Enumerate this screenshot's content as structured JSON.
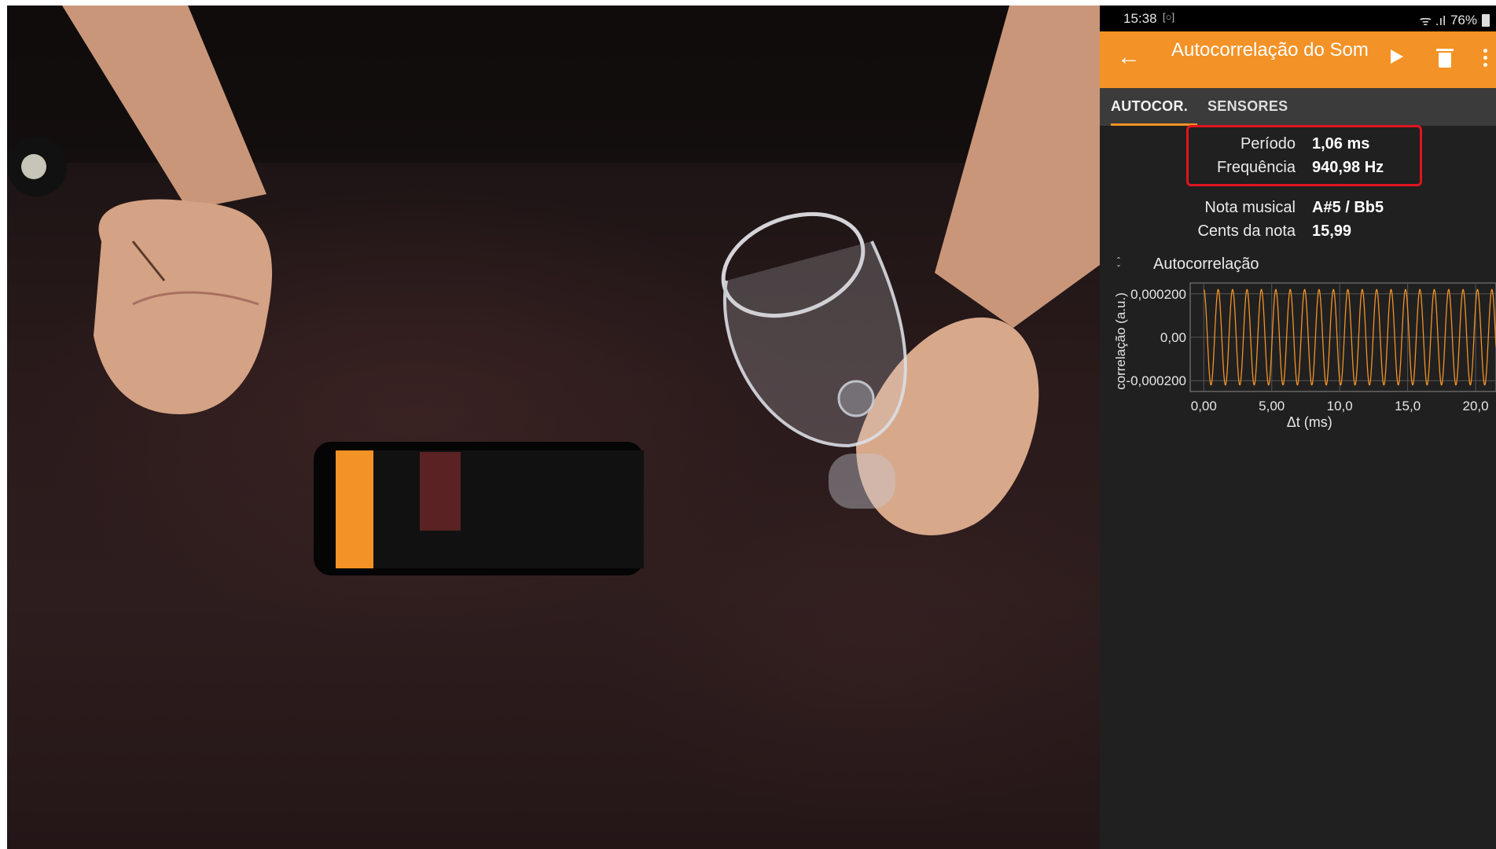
{
  "status_bar": {
    "time": "15:38",
    "signal": "ᯤ .ıl",
    "battery": "76%"
  },
  "toolbar": {
    "title": "Autocorrelação do Som",
    "colors": {
      "accent": "#f39226",
      "background": "#202020"
    }
  },
  "tabs": [
    {
      "label": "AUTOCOR.",
      "active": true
    },
    {
      "label": "SENSORES",
      "active": false
    }
  ],
  "results": [
    {
      "label": "Período",
      "value": "1,06 ms"
    },
    {
      "label": "Frequência",
      "value": "940,98 Hz"
    },
    {
      "label": "Nota musical",
      "value": "A#5 / Bb5"
    },
    {
      "label": "Cents da nota",
      "value": "15,99"
    }
  ],
  "plot": {
    "title": "Autocorrelação"
  },
  "chart_data": {
    "type": "line",
    "title": "Autocorrelação",
    "xlabel": "Δt (ms)",
    "ylabel": "correlação (a.u.)",
    "xlim": [
      -1.0,
      21.5
    ],
    "ylim": [
      -0.00025,
      0.00025
    ],
    "x_ticks": [
      "0,00",
      "5,00",
      "10,0",
      "15,0",
      "20,0"
    ],
    "x_tick_values": [
      0,
      5,
      10,
      15,
      20
    ],
    "y_ticks": [
      "0,000200",
      "0,00",
      "-0,000200"
    ],
    "y_tick_values": [
      0.0002,
      0,
      -0.0002
    ],
    "grid": true,
    "series": [
      {
        "function": "cosine",
        "amplitude": 0.00022,
        "period": 1.06,
        "x_start": 0,
        "x_end": 21.5,
        "color": "#f39226"
      }
    ]
  }
}
